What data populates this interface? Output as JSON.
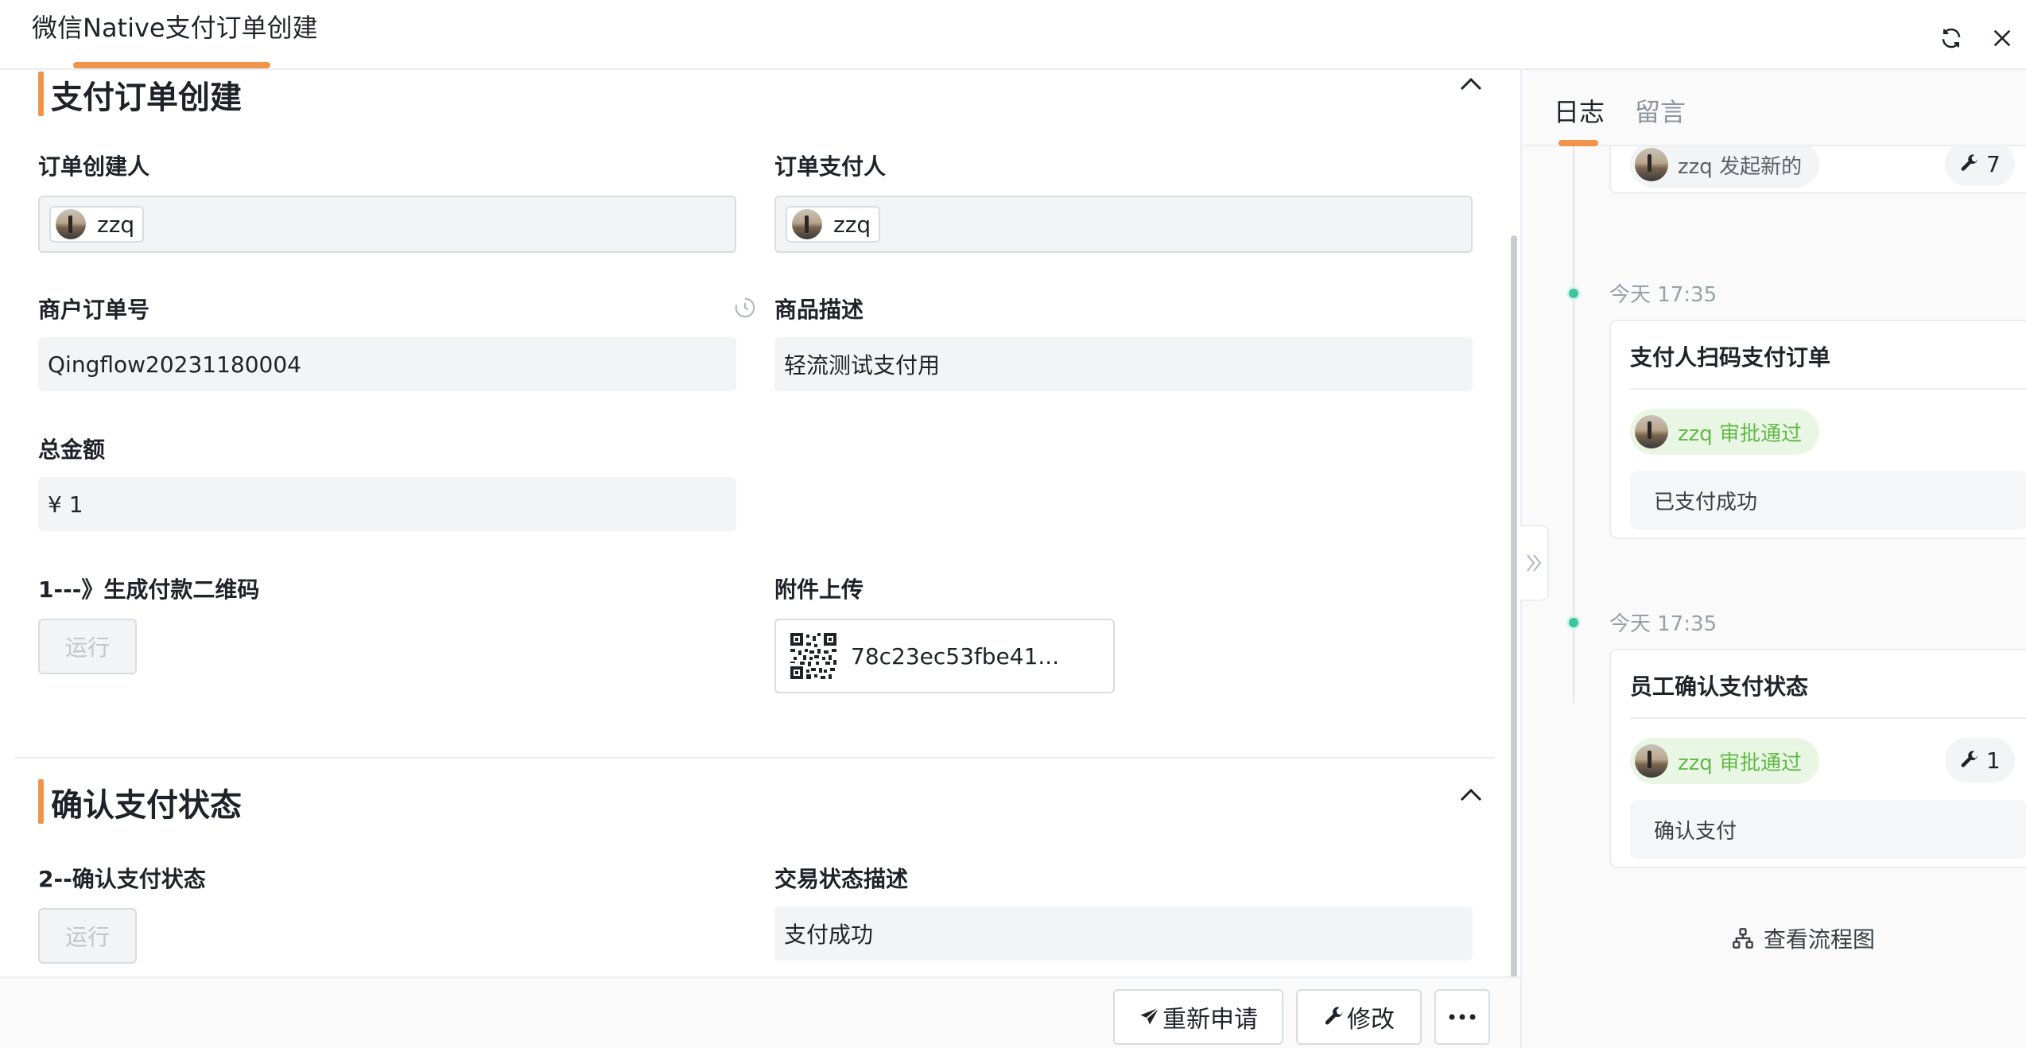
{
  "window": {
    "title": "微信Native支付订单创建"
  },
  "icons": {
    "refresh": "refresh-icon",
    "close": "close-icon",
    "history": "clock-history-icon",
    "send": "paper-plane-icon",
    "wrench": "wrench-icon",
    "more": "more-dots-icon",
    "flow": "flowchart-icon",
    "collapse": "chevron-up-icon",
    "expand": "double-chevron-right-icon"
  },
  "colors": {
    "accent": "#f0944b",
    "approved_text": "#62b84a",
    "approved_bg": "#eaf6e4",
    "timeline_dot": "#3fc4a1"
  },
  "section1": {
    "title": "支付订单创建",
    "creator": {
      "label": "订单创建人",
      "user": "zzq"
    },
    "payer": {
      "label": "订单支付人",
      "user": "zzq"
    },
    "order_no": {
      "label": "商户订单号",
      "value": "Qingflow20231180004"
    },
    "description": {
      "label": "商品描述",
      "value": "轻流测试支付用"
    },
    "amount": {
      "label": "总金额",
      "value": "¥ 1"
    },
    "qrcode": {
      "label": "1---》生成付款二维码",
      "button": "运行"
    },
    "attachment": {
      "label": "附件上传",
      "file_name": "78c23ec53fbe41..."
    }
  },
  "section2": {
    "title": "确认支付状态",
    "confirm": {
      "label": "2--确认支付状态",
      "button": "运行"
    },
    "trade_status": {
      "label": "交易状态描述",
      "value": "支付成功"
    }
  },
  "footer": {
    "reapply": "重新申请",
    "modify": "修改"
  },
  "side_panel": {
    "tabs": [
      {
        "label": "日志"
      },
      {
        "label": "留言"
      }
    ],
    "top_entry": {
      "status": "zzq 发起新的",
      "count": "7"
    },
    "entries": [
      {
        "time": "今天 17:35",
        "title": "支付人扫码支付订单",
        "status": "zzq 审批通过",
        "comment": "已支付成功"
      },
      {
        "time": "今天 17:35",
        "title": "员工确认支付状态",
        "status": "zzq 审批通过",
        "count": "1",
        "comment": "确认支付"
      }
    ],
    "flow_link": "查看流程图"
  }
}
